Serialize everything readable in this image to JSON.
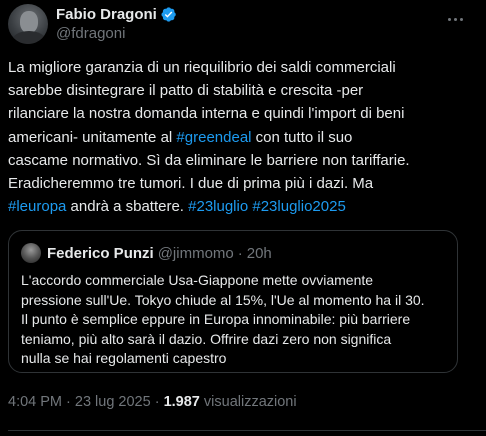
{
  "author": {
    "display_name": "Fabio Dragoni",
    "handle": "@fdragoni",
    "verified": true
  },
  "body": {
    "lines": [
      [
        {
          "text": "La migliore garanzia di un riequilibrio dei saldi commerciali",
          "type": "text"
        }
      ],
      [
        {
          "text": "sarebbe disintegrare il patto di stabilità e crescita -per",
          "type": "text"
        }
      ],
      [
        {
          "text": "rilanciare la nostra domanda interna e quindi l'import di beni",
          "type": "text"
        }
      ],
      [
        {
          "text": "americani- unitamente al ",
          "type": "text"
        },
        {
          "text": "#greendeal",
          "type": "hashtag"
        },
        {
          "text": " con tutto il suo",
          "type": "text"
        }
      ],
      [
        {
          "text": "cascame normativo. Sì da eliminare le barriere non tariffarie.",
          "type": "text"
        }
      ],
      [
        {
          "text": "Eradicheremmo tre tumori. I due di prima più i dazi. Ma",
          "type": "text"
        }
      ],
      [
        {
          "text": "#leuropa",
          "type": "hashtag"
        },
        {
          "text": " andrà a sbattere. ",
          "type": "text"
        },
        {
          "text": "#23luglio",
          "type": "hashtag"
        },
        {
          "text": " ",
          "type": "text"
        },
        {
          "text": "#23luglio2025",
          "type": "hashtag"
        }
      ]
    ]
  },
  "quote": {
    "display_name": "Federico Punzi",
    "handle": "@jimmomo",
    "separator": "·",
    "time": "20h",
    "lines": [
      "L'accordo commerciale Usa-Giappone mette ovviamente",
      "pressione sull'Ue. Tokyo chiude al 15%, l'Ue al momento ha il 30.",
      "Il punto è semplice eppure in Europa innominabile: più barriere",
      "teniamo, più alto sarà il dazio. Offrire dazi zero non significa",
      "nulla se hai regolamenti capestro"
    ]
  },
  "meta": {
    "time": "4:04 PM",
    "sep1": " · ",
    "date": "23 lug 2025",
    "sep2": " · ",
    "views_count": "1.987",
    "views_label": " visualizzazioni"
  },
  "colors": {
    "background": "#000000",
    "text": "#e7e9ea",
    "muted": "#71767b",
    "accent": "#1d9bf0",
    "border": "#2f3336"
  },
  "icons": {
    "verified": "verified-badge-icon",
    "more": "more-horizontal-icon"
  }
}
